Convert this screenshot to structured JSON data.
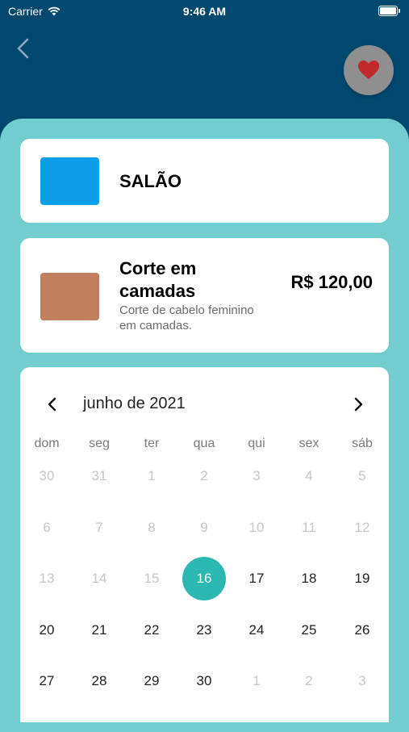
{
  "status_bar": {
    "carrier": "Carrier",
    "time": "9:46 AM"
  },
  "colors": {
    "header_bg": "#01486e",
    "sheet_bg": "#72cece",
    "selected_day": "#2bb8b0",
    "salon_swatch": "#0d9ee8",
    "service_swatch": "#c17f5d",
    "heart": "#c0282c"
  },
  "salon": {
    "name": "SALÃO"
  },
  "service": {
    "name": "Corte em camadas",
    "description": "Corte de cabelo feminino em camadas.",
    "price": "R$ 120,00"
  },
  "calendar": {
    "title": "junho de 2021",
    "weekdays": [
      "dom",
      "seg",
      "ter",
      "qua",
      "qui",
      "sex",
      "sáb"
    ],
    "weeks": [
      [
        {
          "d": "30",
          "s": "muted"
        },
        {
          "d": "31",
          "s": "muted"
        },
        {
          "d": "1",
          "s": "muted"
        },
        {
          "d": "2",
          "s": "muted"
        },
        {
          "d": "3",
          "s": "muted"
        },
        {
          "d": "4",
          "s": "muted"
        },
        {
          "d": "5",
          "s": "muted"
        }
      ],
      [
        {
          "d": "6",
          "s": "muted"
        },
        {
          "d": "7",
          "s": "muted"
        },
        {
          "d": "8",
          "s": "muted"
        },
        {
          "d": "9",
          "s": "muted"
        },
        {
          "d": "10",
          "s": "muted"
        },
        {
          "d": "11",
          "s": "muted"
        },
        {
          "d": "12",
          "s": "muted"
        }
      ],
      [
        {
          "d": "13",
          "s": "muted"
        },
        {
          "d": "14",
          "s": "muted"
        },
        {
          "d": "15",
          "s": "muted"
        },
        {
          "d": "16",
          "s": "selected"
        },
        {
          "d": "17",
          "s": "active"
        },
        {
          "d": "18",
          "s": "active"
        },
        {
          "d": "19",
          "s": "active"
        }
      ],
      [
        {
          "d": "20",
          "s": "active"
        },
        {
          "d": "21",
          "s": "active"
        },
        {
          "d": "22",
          "s": "active"
        },
        {
          "d": "23",
          "s": "active"
        },
        {
          "d": "24",
          "s": "active"
        },
        {
          "d": "25",
          "s": "active"
        },
        {
          "d": "26",
          "s": "active"
        }
      ],
      [
        {
          "d": "27",
          "s": "active"
        },
        {
          "d": "28",
          "s": "active"
        },
        {
          "d": "29",
          "s": "active"
        },
        {
          "d": "30",
          "s": "active"
        },
        {
          "d": "1",
          "s": "muted"
        },
        {
          "d": "2",
          "s": "muted"
        },
        {
          "d": "3",
          "s": "muted"
        }
      ]
    ]
  },
  "icons": {
    "back": "chevron-left-icon",
    "favorite": "heart-icon",
    "prev_month": "chevron-left-icon",
    "next_month": "chevron-right-icon",
    "wifi": "wifi-icon",
    "battery": "battery-icon"
  }
}
